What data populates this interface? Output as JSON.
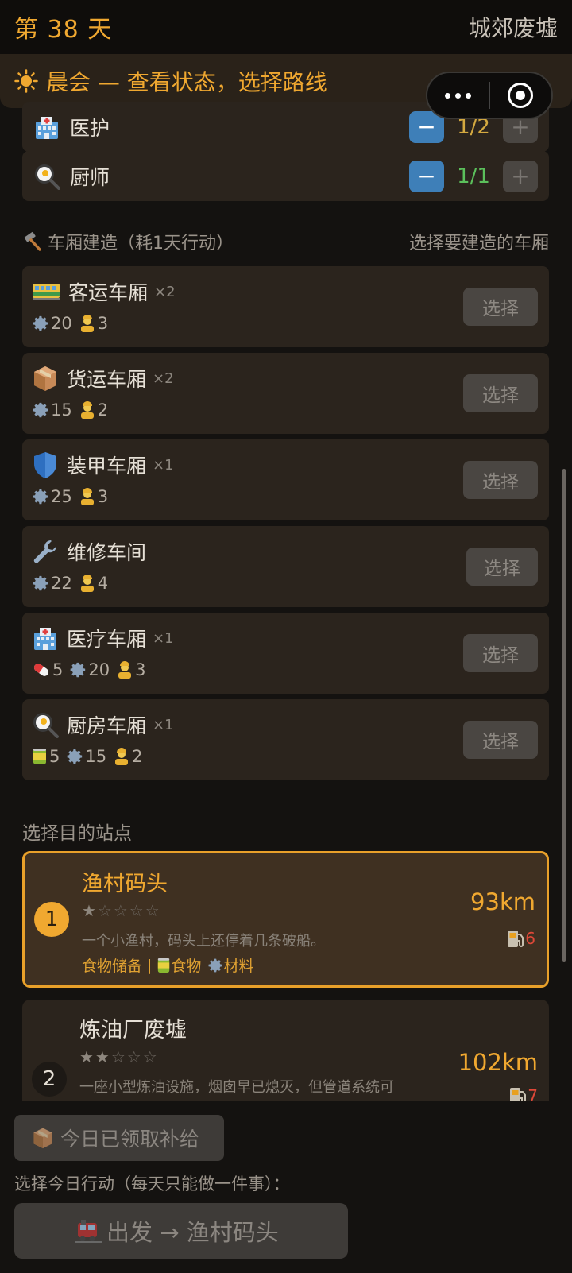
{
  "header": {
    "day": "第 38 天",
    "location": "城郊废墟"
  },
  "phase": {
    "label": "晨会 — 查看状态，选择路线"
  },
  "staff": [
    {
      "name": "医护",
      "icon": "hospital-icon",
      "value": "1/2",
      "value_color": "#d4a940"
    },
    {
      "name": "厨师",
      "icon": "frying-pan-icon",
      "value": "1/1",
      "value_color": "#5bbf5b"
    }
  ],
  "stepper": {
    "minus": "−",
    "plus": "+"
  },
  "build": {
    "title": "车厢建造（耗1天行动）",
    "hint": "选择要建造的车厢",
    "select_label": "选择",
    "cars": [
      {
        "name": "客运车厢",
        "count": "×2",
        "icon": "passenger-car-icon",
        "costs": [
          {
            "icon": "gear-icon",
            "value": "20"
          },
          {
            "icon": "worker-icon",
            "value": "3"
          }
        ]
      },
      {
        "name": "货运车厢",
        "count": "×2",
        "icon": "package-icon",
        "costs": [
          {
            "icon": "gear-icon",
            "value": "15"
          },
          {
            "icon": "worker-icon",
            "value": "2"
          }
        ]
      },
      {
        "name": "装甲车厢",
        "count": "×1",
        "icon": "shield-icon",
        "costs": [
          {
            "icon": "gear-icon",
            "value": "25"
          },
          {
            "icon": "worker-icon",
            "value": "3"
          }
        ]
      },
      {
        "name": "维修车间",
        "count": "",
        "icon": "wrench-icon",
        "costs": [
          {
            "icon": "gear-icon",
            "value": "22"
          },
          {
            "icon": "worker-icon",
            "value": "4"
          }
        ]
      },
      {
        "name": "医疗车厢",
        "count": "×1",
        "icon": "hospital-icon",
        "costs": [
          {
            "icon": "pill-icon",
            "value": "5"
          },
          {
            "icon": "gear-icon",
            "value": "20"
          },
          {
            "icon": "worker-icon",
            "value": "3"
          }
        ]
      },
      {
        "name": "厨房车厢",
        "count": "×1",
        "icon": "frying-pan-icon",
        "costs": [
          {
            "icon": "can-icon",
            "value": "5"
          },
          {
            "icon": "gear-icon",
            "value": "15"
          },
          {
            "icon": "worker-icon",
            "value": "2"
          }
        ]
      }
    ]
  },
  "destinations": {
    "title": "选择目的站点",
    "items": [
      {
        "num": "1",
        "name": "渔村码头",
        "stars": 1,
        "star_max": 5,
        "desc": "一个小渔村，码头上还停着几条破船。",
        "tags": [
          "食物储备",
          "|",
          "食物",
          "材料"
        ],
        "distance": "93km",
        "fuel": "6",
        "selected": true
      },
      {
        "num": "2",
        "name": "炼油厂废墟",
        "stars": 2,
        "star_max": 5,
        "desc": "一座小型炼油设施，烟囱早已熄灭，但管道系统可",
        "distance": "102km",
        "fuel": "7",
        "selected": false
      }
    ]
  },
  "actions": {
    "supply_label": "今日已领取补给",
    "hint": "选择今日行动（每天只能做一件事）：",
    "depart_label": "出发 → 渔村码头"
  },
  "colors": {
    "accent": "#f0a830",
    "card": "#2b241d",
    "button_blue": "#3e7fb8"
  }
}
